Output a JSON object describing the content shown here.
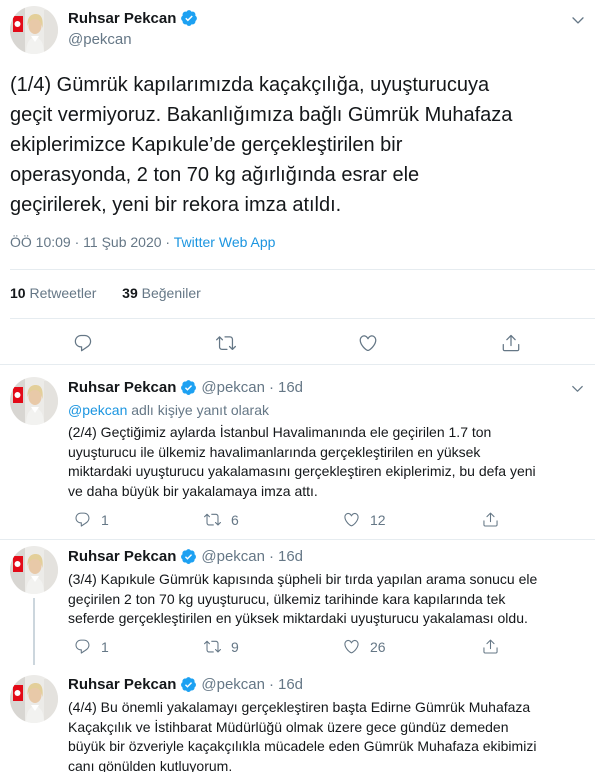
{
  "main_tweet": {
    "name": "Ruhsar Pekcan",
    "handle": "@pekcan",
    "text": "(1/4) Gümrük kapılarımızda kaçakçılığa, uyuşturucuya\ngeçit vermiyoruz. Bakanlığımıza bağlı Gümrük Muhafaza\nekiplerimizce Kapıkule’de gerçekleştirilen bir\noperasyonda, 2 ton 70 kg ağırlığında esrar ele\ngeçirilerek, yeni bir rekora imza atıldı.",
    "time": "ÖÖ 10:09",
    "date": "11 Şub 2020",
    "separator": "·",
    "via": "Twitter Web App",
    "retweets_count": "10",
    "retweets_label": "Retweetler",
    "likes_count": "39",
    "likes_label": "Beğeniler"
  },
  "replies": [
    {
      "name": "Ruhsar Pekcan",
      "handle": "@pekcan",
      "dot": "·",
      "age": "16d",
      "reply_to_mention": "@pekcan",
      "reply_to_suffix": "adlı kişiye yanıt olarak",
      "text": "(2/4) Geçtiğimiz aylarda İstanbul Havalimanında ele geçirilen 1.7 ton\nuyuşturucu ile ülkemiz havalimanlarında gerçekleştirilen en yüksek\nmiktardaki uyuşturucu yakalamasını gerçekleştiren ekiplerimiz, bu defa yeni\nve daha büyük bir yakalamaya imza attı.",
      "reply_count": "1",
      "retweet_count": "6",
      "like_count": "12"
    },
    {
      "name": "Ruhsar Pekcan",
      "handle": "@pekcan",
      "dot": "·",
      "age": "16d",
      "text": "(3/4) Kapıkule Gümrük kapısında şüpheli bir tırda yapılan arama sonucu ele\ngeçirilen  2 ton 70 kg uyuşturucu, ülkemiz tarihinde kara kapılarında tek\nseferde gerçekleştirilen en yüksek miktardaki uyuşturucu yakalaması oldu.",
      "reply_count": "1",
      "retweet_count": "9",
      "like_count": "26"
    },
    {
      "name": "Ruhsar Pekcan",
      "handle": "@pekcan",
      "dot": "·",
      "age": "16d",
      "text": "(4/4) Bu önemli yakalamayı gerçekleştiren  başta Edirne Gümrük Muhafaza\nKaçakçılık ve İstihbarat Müdürlüğü olmak üzere gece gündüz demeden\nbüyük bir özveriyle kaçakçılıkla mücadele eden Gümrük Muhafaza ekibimizi\ncanı gönülden kutluyorum."
    }
  ],
  "colors": {
    "accent": "#1b95e0",
    "verified": "#1da1f2",
    "muted": "#657786",
    "divider": "#e6ecf0",
    "flag_red": "#e30a17"
  },
  "icons": [
    "verified-badge-icon",
    "chevron-down-icon",
    "reply-icon",
    "retweet-icon",
    "like-icon",
    "share-icon"
  ]
}
